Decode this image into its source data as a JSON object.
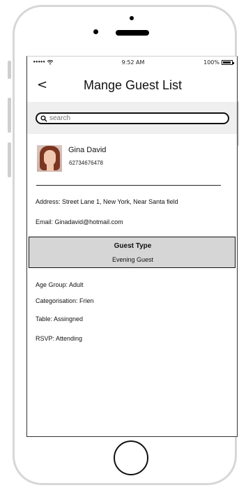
{
  "status_bar": {
    "signal": "•••••",
    "time": "9:52 AM",
    "battery": "100%"
  },
  "header": {
    "back_symbol": "<",
    "title": "Mange Guest List"
  },
  "search": {
    "placeholder": "search"
  },
  "contact": {
    "name": "Gina David",
    "phone": "62734676478",
    "address": "Address: Street Lane 1, New York, Near Santa field",
    "email": "Email: Ginadavid@hotmail.com"
  },
  "guest_type": {
    "label": "Guest Type",
    "value": "Evening Guest"
  },
  "details": {
    "age_group": "Age Group: Adult",
    "categorisation": "Categorisation: Frien",
    "table": "Table: Assingned",
    "rsvp": "RSVP: Attending"
  },
  "icons": {
    "wifi": "wifi-icon",
    "battery": "battery-icon",
    "search": "search-icon"
  }
}
